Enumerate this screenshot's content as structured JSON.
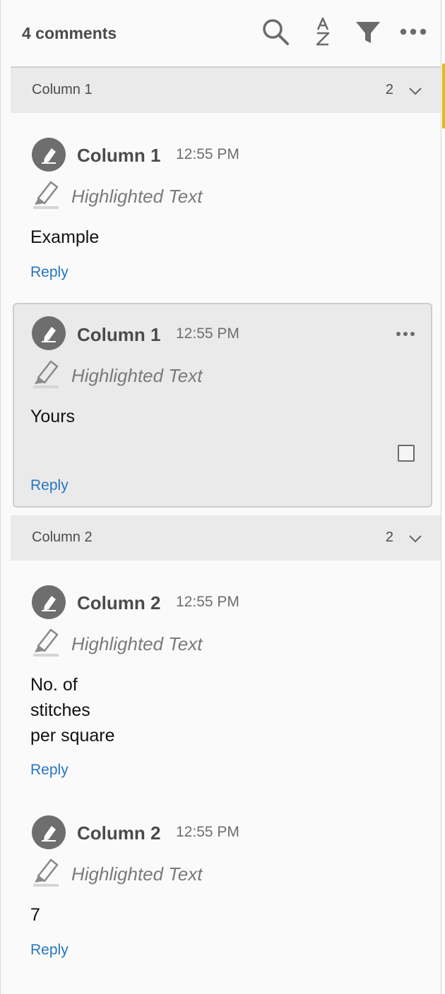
{
  "header": {
    "title": "4 comments",
    "icons": [
      "search-icon",
      "sort-az-icon",
      "filter-icon",
      "more-icon"
    ]
  },
  "groups": [
    {
      "title": "Column 1",
      "count": "2",
      "comments": [
        {
          "author": "Column 1",
          "time": "12:55 PM",
          "type": "Highlighted Text",
          "text": "Example",
          "reply": "Reply"
        },
        {
          "author": "Column 1",
          "time": "12:55 PM",
          "type": "Highlighted Text",
          "text": "Yours",
          "reply": "Reply"
        }
      ]
    },
    {
      "title": "Column 2",
      "count": "2",
      "comments": [
        {
          "author": "Column 2",
          "time": "12:55 PM",
          "type": "Highlighted Text",
          "text": "No. of\nstitches\nper square",
          "reply": "Reply"
        },
        {
          "author": "Column 2",
          "time": "12:55 PM",
          "type": "Highlighted Text",
          "text": "7",
          "reply": "Reply"
        }
      ]
    }
  ],
  "colors": {
    "avatar": "#6e6e6e",
    "link": "#2676c0",
    "group_bg": "#eaeaea",
    "scroll_thumb": "#e3b81c"
  }
}
